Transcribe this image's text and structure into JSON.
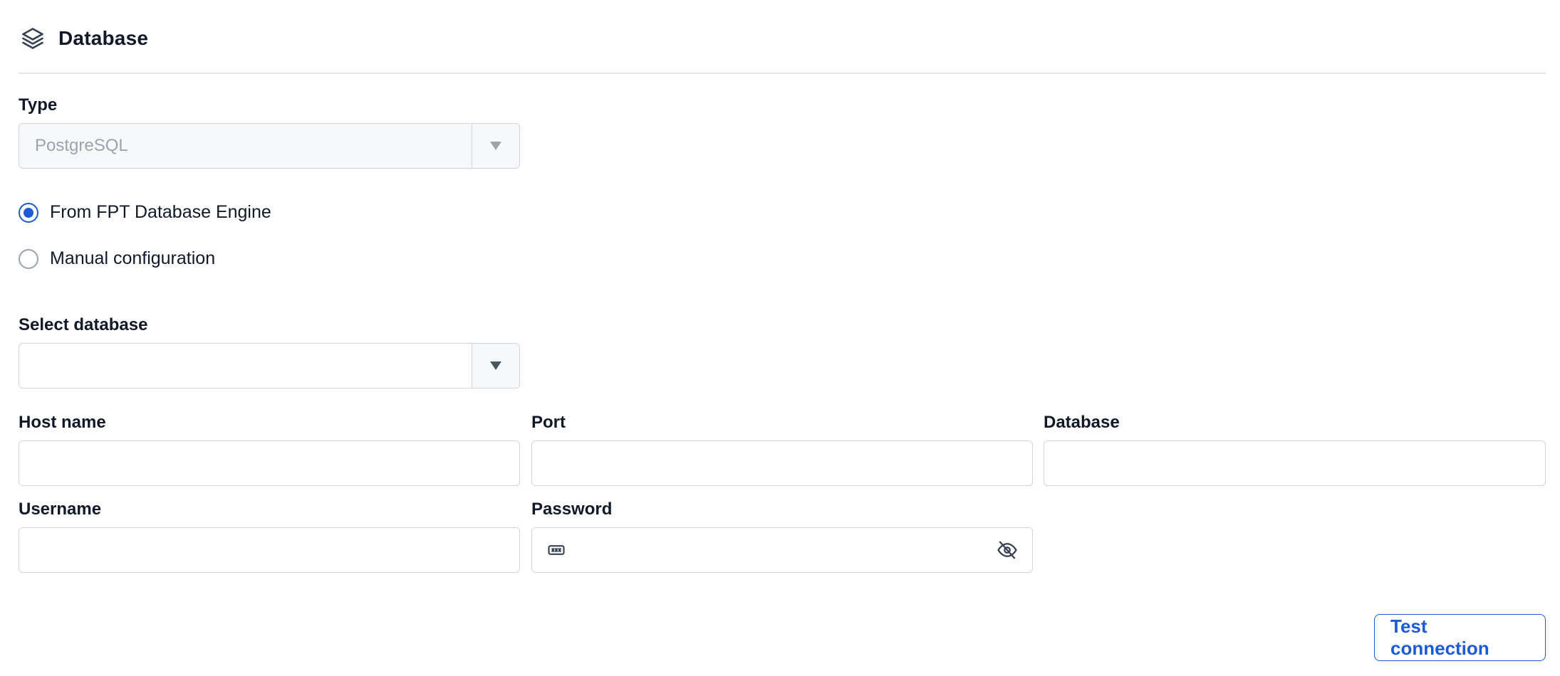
{
  "header": {
    "title": "Database",
    "icon": "layers-icon"
  },
  "type_field": {
    "label": "Type",
    "value": "PostgreSQL"
  },
  "source": {
    "options": [
      {
        "label": "From FPT Database Engine",
        "checked": true
      },
      {
        "label": "Manual configuration",
        "checked": false
      }
    ]
  },
  "select_database": {
    "label": "Select database",
    "value": ""
  },
  "fields": {
    "host": {
      "label": "Host name",
      "value": ""
    },
    "port": {
      "label": "Port",
      "value": ""
    },
    "database": {
      "label": "Database",
      "value": ""
    },
    "username": {
      "label": "Username",
      "value": ""
    },
    "password": {
      "label": "Password",
      "value": ""
    }
  },
  "actions": {
    "test_connection": "Test connection"
  },
  "colors": {
    "accent": "#1d5bd6",
    "border": "#d1d5db",
    "muted": "#9ca3af"
  }
}
